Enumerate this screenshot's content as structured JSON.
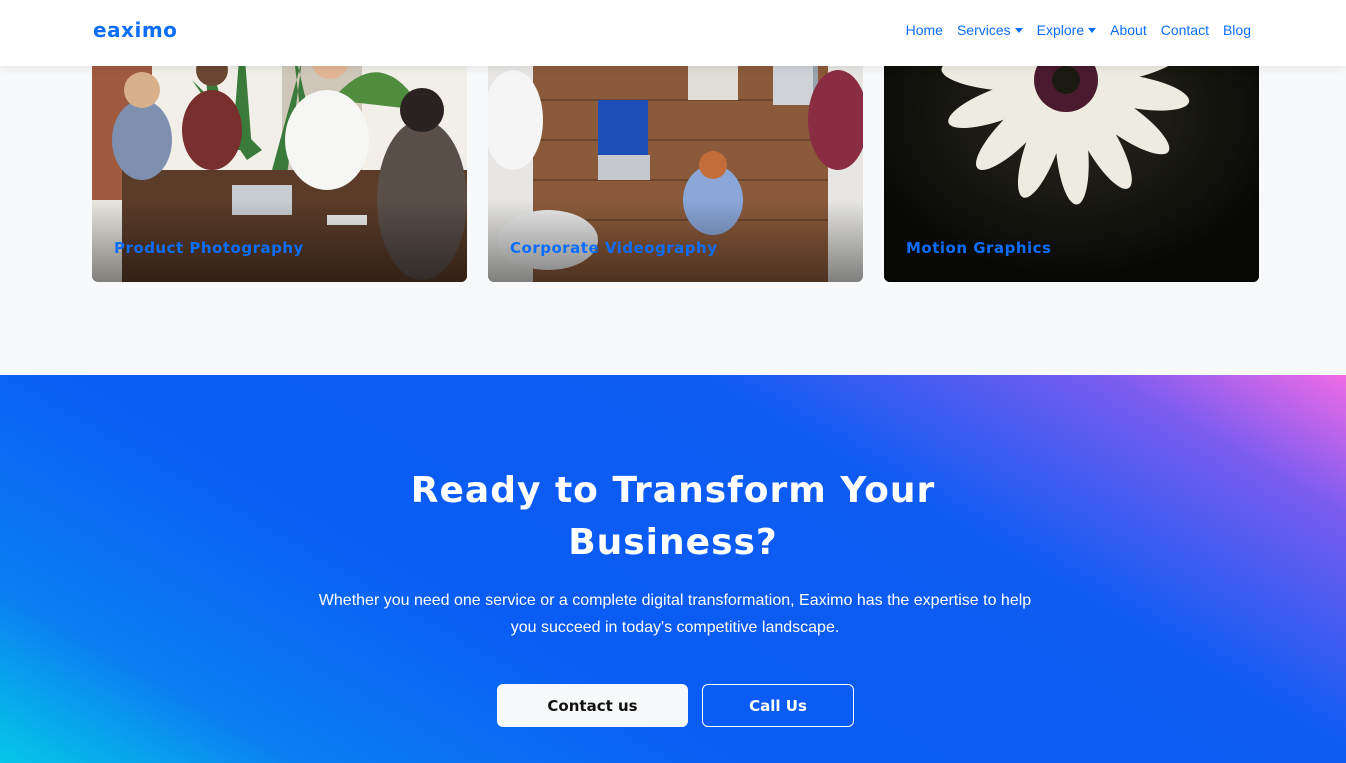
{
  "navbar": {
    "brand": "eaximo",
    "links": [
      {
        "label": "Home"
      },
      {
        "label": "Services"
      },
      {
        "label": "Explore"
      },
      {
        "label": "About"
      },
      {
        "label": "Contact"
      },
      {
        "label": "Blog"
      }
    ]
  },
  "cards": [
    {
      "title": "Product Photography"
    },
    {
      "title": "Corporate Videography"
    },
    {
      "title": "Motion Graphics"
    }
  ],
  "cta": {
    "heading_line1": "Ready to Transform Your",
    "heading_line2": "Business?",
    "text": "Whether you need one service or a complete digital transformation, Eaximo has the expertise to help you succeed in today's competitive landscape.",
    "contact_button": "Contact us",
    "call_button": "Call Us"
  },
  "colors": {
    "accent": "#0d6efd",
    "cta_start": "#06c8e8",
    "cta_mid": "#0a5cf5",
    "cta_end": "#f06be6"
  }
}
